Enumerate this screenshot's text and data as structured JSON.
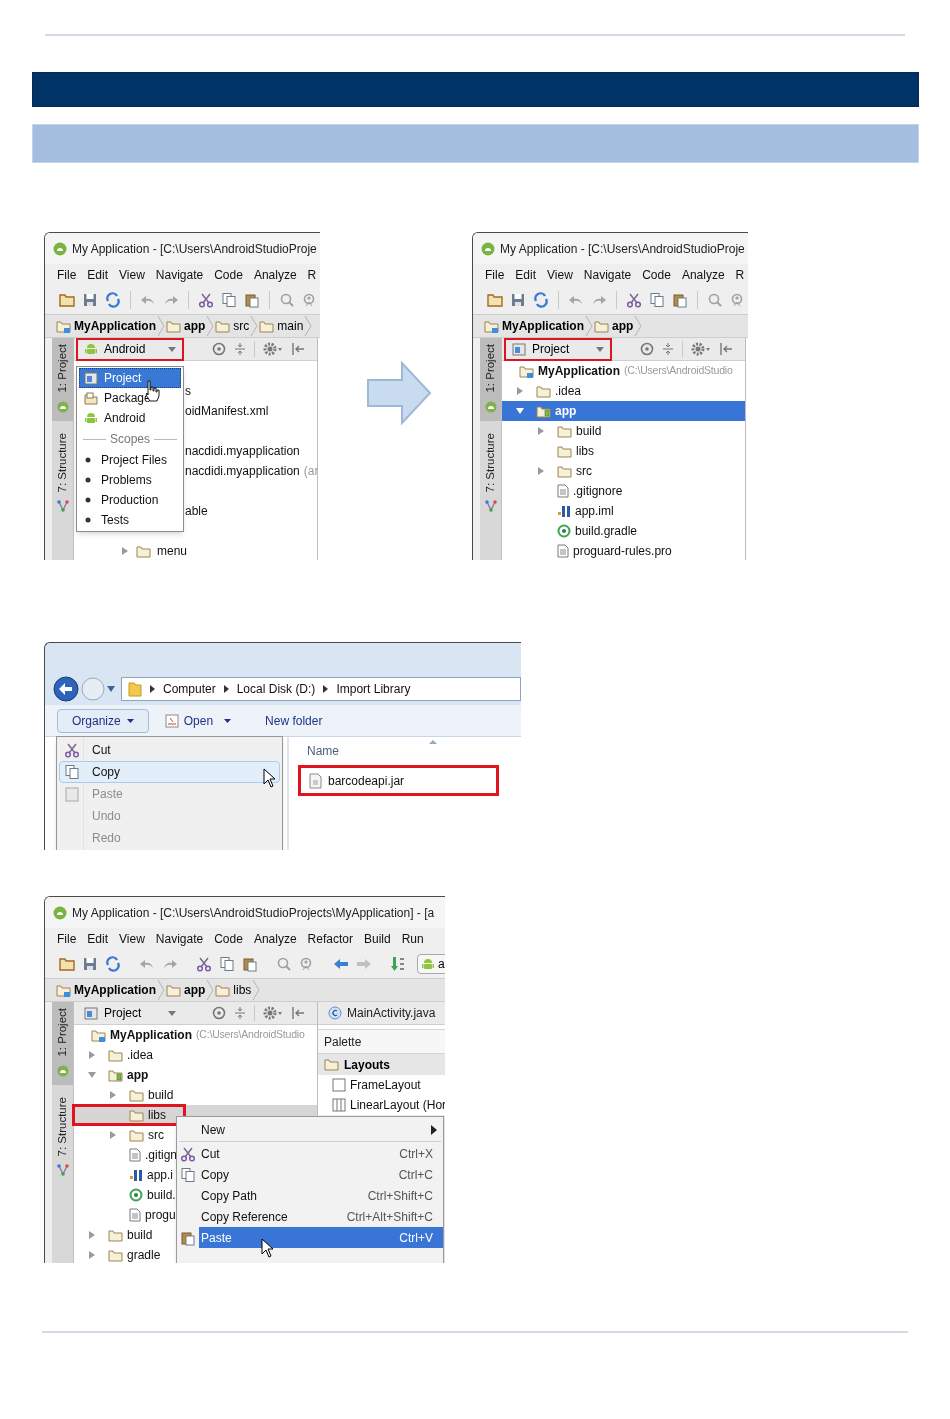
{
  "android_view_menu": {
    "window_title": "My Application - [C:\\Users\\AndroidStudioProje",
    "menu_bar": [
      "File",
      "Edit",
      "View",
      "Navigate",
      "Code",
      "Analyze",
      "R"
    ],
    "breadcrumbs": [
      {
        "label": "MyApplication",
        "bold": true
      },
      {
        "label": "app",
        "bold": true
      },
      {
        "label": "src",
        "bold": false
      },
      {
        "label": "main",
        "bold": false
      }
    ],
    "side_tabs": [
      {
        "label": "1: Project",
        "selected": true
      },
      {
        "label": "7: Structure",
        "selected": false
      }
    ],
    "view_selector": {
      "label": "Android",
      "highlighted": true
    },
    "tree_rows": [
      {
        "kind": "blank"
      },
      {
        "kind": "text",
        "label": "s"
      },
      {
        "kind": "text",
        "label": "oidManifest.xml"
      },
      {
        "kind": "blank"
      },
      {
        "kind": "text",
        "label": "nacdidi.myapplication"
      },
      {
        "kind": "text",
        "label": "nacdidi.myapplication",
        "note": "(ar"
      },
      {
        "kind": "blank"
      },
      {
        "kind": "text",
        "label": "able"
      },
      {
        "kind": "blank"
      },
      {
        "kind": "folder",
        "label": "menu"
      }
    ],
    "view_menu": {
      "items": [
        {
          "label": "Project",
          "selected": true
        },
        {
          "label": "Package",
          "selected": false
        },
        {
          "label": "Android",
          "selected": false
        }
      ],
      "scopes_heading": "Scopes",
      "scopes": [
        "Project Files",
        "Problems",
        "Production",
        "Tests"
      ]
    }
  },
  "project_view": {
    "window_title": "My Application - [C:\\Users\\AndroidStudioProje",
    "menu_bar": [
      "File",
      "Edit",
      "View",
      "Navigate",
      "Code",
      "Analyze",
      "R"
    ],
    "breadcrumbs": [
      {
        "label": "MyApplication",
        "bold": true
      },
      {
        "label": "app",
        "bold": true
      }
    ],
    "side_tabs": [
      {
        "label": "1: Project",
        "selected": true
      },
      {
        "label": "7: Structure",
        "selected": false
      }
    ],
    "view_selector": {
      "label": "Project",
      "highlighted": true
    },
    "tree_focused": true,
    "tree": [
      {
        "label": "MyApplication",
        "note": "(C:\\Users\\AndroidStudio",
        "kind": "module",
        "selected": false,
        "children": [
          {
            "label": ".idea",
            "kind": "folder",
            "expanded": false,
            "selected": false
          },
          {
            "label": "app",
            "kind": "app",
            "expanded": true,
            "selected": true,
            "children": [
              {
                "label": "build",
                "kind": "folder",
                "expanded": false,
                "selected": false
              },
              {
                "label": "libs",
                "kind": "folder",
                "selected": false
              },
              {
                "label": "src",
                "kind": "folder",
                "expanded": false,
                "selected": false
              },
              {
                "label": ".gitignore",
                "kind": "file",
                "selected": false
              },
              {
                "label": "app.iml",
                "kind": "iml",
                "selected": false
              },
              {
                "label": "build.gradle",
                "kind": "gradle",
                "selected": false
              },
              {
                "label": "proguard-rules.pro",
                "kind": "file",
                "selected": false
              }
            ]
          }
        ]
      }
    ]
  },
  "file_explorer": {
    "address": [
      "Computer",
      "Local Disk (D:)",
      "Import Library"
    ],
    "toolbar": [
      {
        "label": "Organize",
        "kind": "menu"
      },
      {
        "label": "Open",
        "kind": "split"
      },
      {
        "label": "New folder",
        "kind": "plain"
      }
    ],
    "organize_menu": [
      {
        "label": "Cut",
        "disabled": false,
        "selected": false
      },
      {
        "label": "Copy",
        "disabled": false,
        "selected": true
      },
      {
        "label": "Paste",
        "disabled": true,
        "selected": false
      },
      {
        "label": "Undo",
        "disabled": true,
        "selected": false
      },
      {
        "label": "Redo",
        "disabled": true,
        "selected": false
      }
    ],
    "column": "Name",
    "files": [
      {
        "label": "barcodeapi.jar",
        "highlighted": true
      }
    ]
  },
  "paste_into_libs": {
    "window_title": "My Application - [C:\\Users\\AndroidStudioProjects\\MyApplication] - [a",
    "menu_bar": [
      "File",
      "Edit",
      "View",
      "Navigate",
      "Code",
      "Analyze",
      "Refactor",
      "Build",
      "Run"
    ],
    "run_config": "a",
    "breadcrumbs": [
      {
        "label": "MyApplication",
        "bold": true
      },
      {
        "label": "app",
        "bold": true
      },
      {
        "label": "libs",
        "bold": false
      }
    ],
    "side_tabs": [
      {
        "label": "1: Project",
        "selected": true
      },
      {
        "label": "7: Structure",
        "selected": false
      }
    ],
    "view_selector": {
      "label": "Project",
      "highlighted": false
    },
    "tree_focused": false,
    "tree": [
      {
        "label": "MyApplication",
        "note": "(C:\\Users\\AndroidStudio",
        "kind": "module",
        "selected": false,
        "highlighted": false,
        "children": [
          {
            "label": ".idea",
            "kind": "folder",
            "expanded": false,
            "selected": false,
            "highlighted": false
          },
          {
            "label": "app",
            "kind": "app",
            "expanded": true,
            "selected": false,
            "highlighted": false,
            "children": [
              {
                "label": "build",
                "kind": "folder",
                "expanded": false,
                "selected": false,
                "highlighted": false
              },
              {
                "label": "libs",
                "kind": "folder",
                "selected": true,
                "highlighted": true
              },
              {
                "label": "src",
                "kind": "folder",
                "expanded": false,
                "selected": false,
                "highlighted": false
              },
              {
                "label": ".gitign",
                "kind": "file",
                "selected": false,
                "highlighted": false
              },
              {
                "label": "app.i",
                "kind": "iml",
                "selected": false,
                "highlighted": false
              },
              {
                "label": "build.",
                "kind": "gradle",
                "selected": false,
                "highlighted": false
              },
              {
                "label": "progu",
                "kind": "file",
                "selected": false,
                "highlighted": false
              }
            ]
          },
          {
            "label": "build",
            "kind": "folder",
            "expanded": false,
            "selected": false,
            "highlighted": false
          },
          {
            "label": "gradle",
            "kind": "folder",
            "expanded": false,
            "selected": false,
            "highlighted": false
          }
        ]
      }
    ],
    "editor_tab": "MainActivity.java",
    "palette": {
      "title": "Palette",
      "group": "Layouts",
      "items": [
        "FrameLayout",
        "LinearLayout (Hor"
      ]
    },
    "context_menu": [
      {
        "kind": "submenu",
        "label": "New",
        "selected": false
      },
      {
        "kind": "separator"
      },
      {
        "kind": "item",
        "label": "Cut",
        "shortcut": "Ctrl+X",
        "selected": false
      },
      {
        "kind": "item",
        "label": "Copy",
        "shortcut": "Ctrl+C",
        "selected": false
      },
      {
        "kind": "item",
        "label": "Copy Path",
        "shortcut": "Ctrl+Shift+C",
        "selected": false
      },
      {
        "kind": "item",
        "label": "Copy Reference",
        "shortcut": "Ctrl+Alt+Shift+C",
        "selected": false
      },
      {
        "kind": "item",
        "label": "Paste",
        "shortcut": "Ctrl+V",
        "selected": true
      }
    ]
  }
}
